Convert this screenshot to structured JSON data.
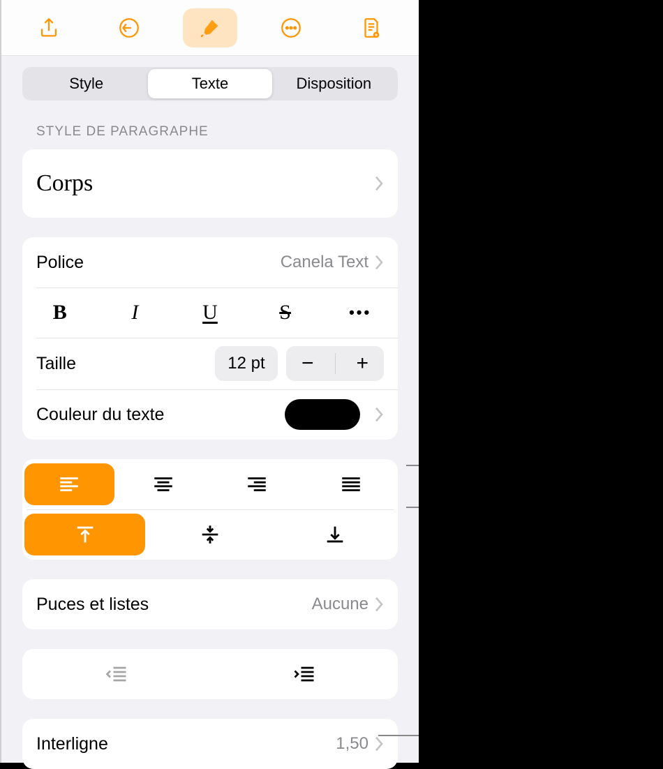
{
  "tabs": {
    "style": "Style",
    "texte": "Texte",
    "disposition": "Disposition"
  },
  "paragraphStyle": {
    "header": "STYLE DE PARAGRAPHE",
    "value": "Corps"
  },
  "font": {
    "label": "Police",
    "value": "Canela Text"
  },
  "fontStyles": {
    "bold": "B",
    "italic": "I",
    "underline": "U",
    "strike": "S",
    "more": "•••"
  },
  "size": {
    "label": "Taille",
    "value": "12 pt",
    "minus": "−",
    "plus": "+"
  },
  "color": {
    "label": "Couleur du texte",
    "value": "#000000"
  },
  "bullets": {
    "label": "Puces et listes",
    "value": "Aucune"
  },
  "lineSpacing": {
    "label": "Interligne",
    "value": "1,50"
  }
}
